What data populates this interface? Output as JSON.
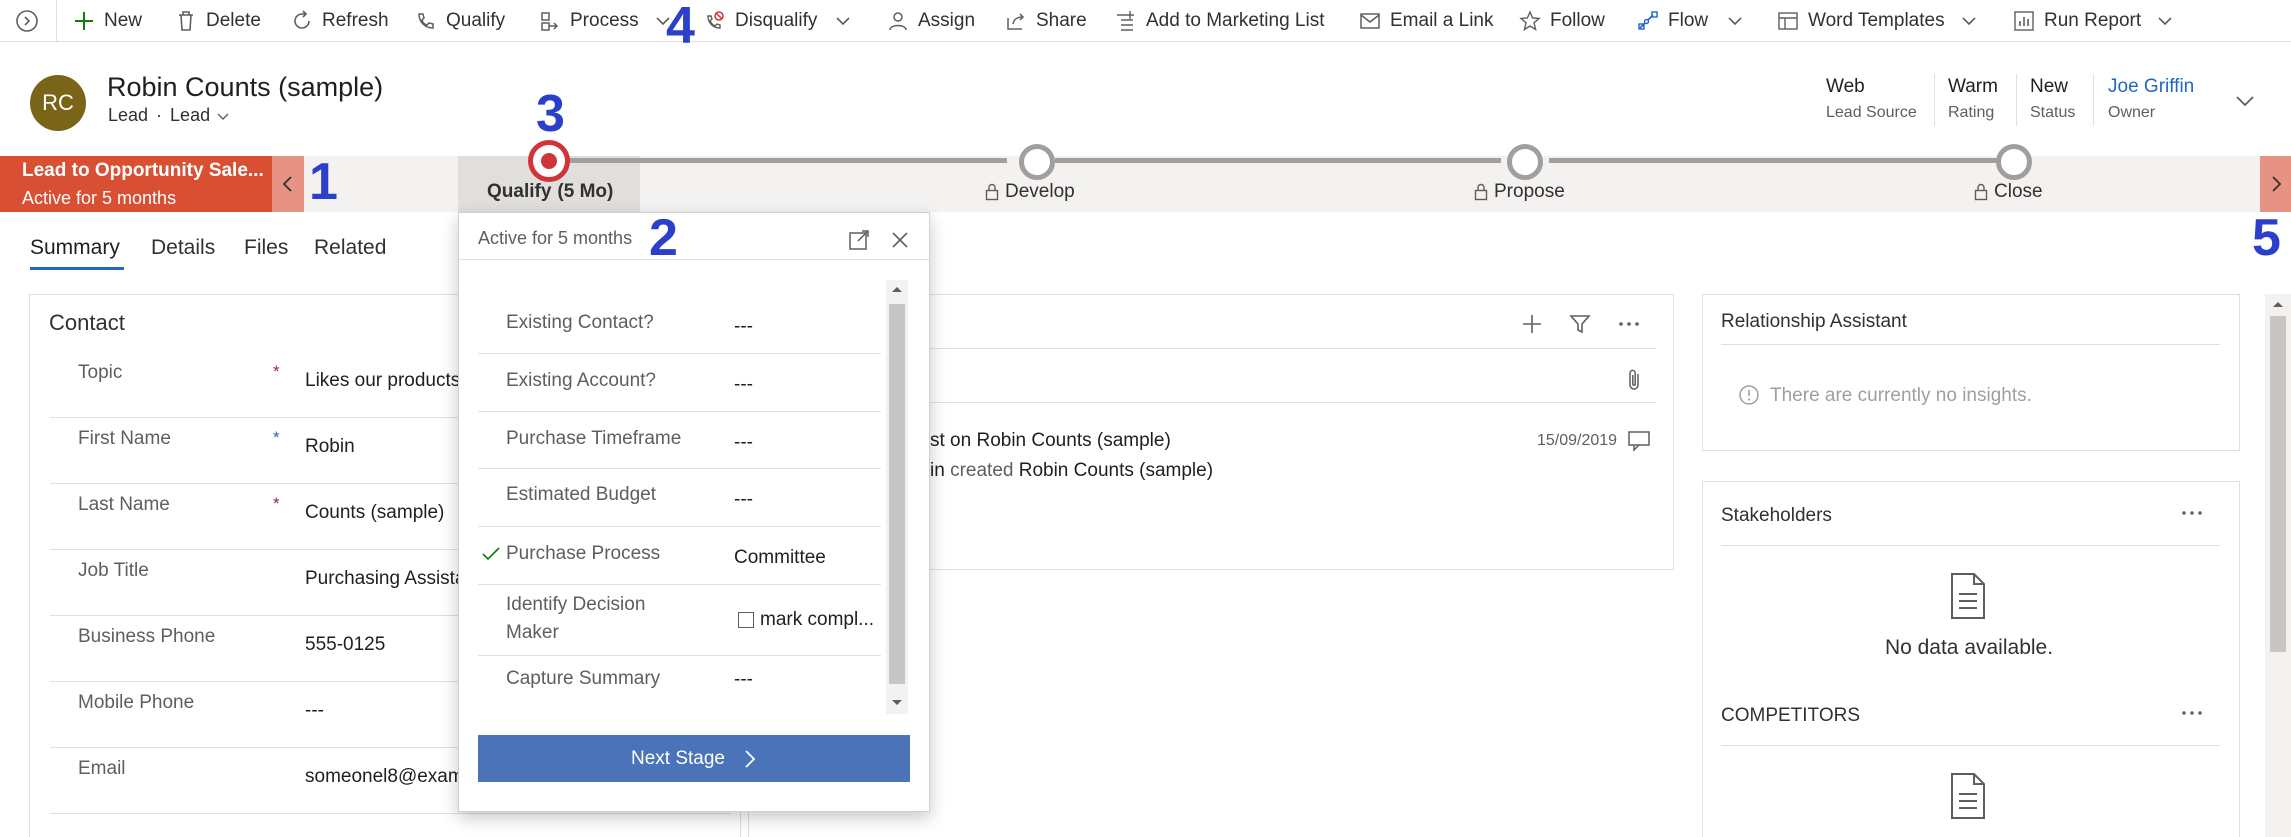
{
  "commands": {
    "new": "New",
    "delete": "Delete",
    "refresh": "Refresh",
    "qualify": "Qualify",
    "process": "Process",
    "disqualify": "Disqualify",
    "assign": "Assign",
    "share": "Share",
    "add_to_marketing_list": "Add to Marketing List",
    "email_a_link": "Email a Link",
    "follow": "Follow",
    "flow": "Flow",
    "word_templates": "Word Templates",
    "run_report": "Run Report"
  },
  "record": {
    "initials": "RC",
    "title": "Robin Counts (sample)",
    "entity": "Lead",
    "form": "Lead",
    "avatar_color": "#7a6417"
  },
  "header_fields": [
    {
      "value": "Web",
      "label": "Lead Source"
    },
    {
      "value": "Warm",
      "label": "Rating"
    },
    {
      "value": "New",
      "label": "Status"
    },
    {
      "value": "Joe Griffin",
      "label": "Owner"
    }
  ],
  "bpf": {
    "process_name": "Lead to Opportunity Sale...",
    "process_status": "Active for 5 months",
    "accent": "#d84f34",
    "stages": [
      {
        "name": "Qualify",
        "duration": "(5 Mo)",
        "active": true
      },
      {
        "name": "Develop",
        "locked": true
      },
      {
        "name": "Propose",
        "locked": true
      },
      {
        "name": "Close",
        "locked": true
      }
    ]
  },
  "flyout": {
    "status": "Active for 5 months",
    "fields": [
      {
        "label": "Existing Contact?",
        "value": "---"
      },
      {
        "label": "Existing Account?",
        "value": "---"
      },
      {
        "label": "Purchase Timeframe",
        "value": "---"
      },
      {
        "label": "Estimated Budget",
        "value": "---"
      },
      {
        "label": "Purchase Process",
        "value": "Committee",
        "completed": true
      },
      {
        "label": "Identify Decision Maker",
        "value": "mark compl...",
        "checkbox": true,
        "checked": false
      },
      {
        "label": "Capture Summary",
        "value": "---"
      }
    ],
    "next_stage": "Next Stage"
  },
  "tabs": [
    {
      "label": "Summary",
      "active": true
    },
    {
      "label": "Details"
    },
    {
      "label": "Files"
    },
    {
      "label": "Related"
    }
  ],
  "contact": {
    "title": "Contact",
    "fields": [
      {
        "label": "Topic",
        "value": "Likes our products",
        "required": "*"
      },
      {
        "label": "First Name",
        "value": "Robin",
        "required": "*"
      },
      {
        "label": "Last Name",
        "value": "Counts (sample)",
        "required": "*"
      },
      {
        "label": "Job Title",
        "value": "Purchasing Assista"
      },
      {
        "label": "Business Phone",
        "value": "555-0125"
      },
      {
        "label": "Mobile Phone",
        "value": "---"
      },
      {
        "label": "Email",
        "value": "someonel8@exam"
      }
    ]
  },
  "timeline": {
    "post_title": "st on Robin Counts (sample)",
    "post_author": "in",
    "post_verb": "created",
    "post_object": "Robin Counts (sample)",
    "post_date": "15/09/2019"
  },
  "relationship_assistant": {
    "title": "Relationship Assistant",
    "empty": "There are currently no insights."
  },
  "stakeholders": {
    "title": "Stakeholders",
    "empty": "No data available."
  },
  "competitors": {
    "title": "COMPETITORS"
  },
  "annotations": [
    "1",
    "2",
    "3",
    "4",
    "5"
  ],
  "colors": {
    "annotation": "#2c3fcb",
    "link": "#2266c6",
    "next_stage_button": "#4a73b9",
    "stage_active_ring": "#d13438"
  }
}
